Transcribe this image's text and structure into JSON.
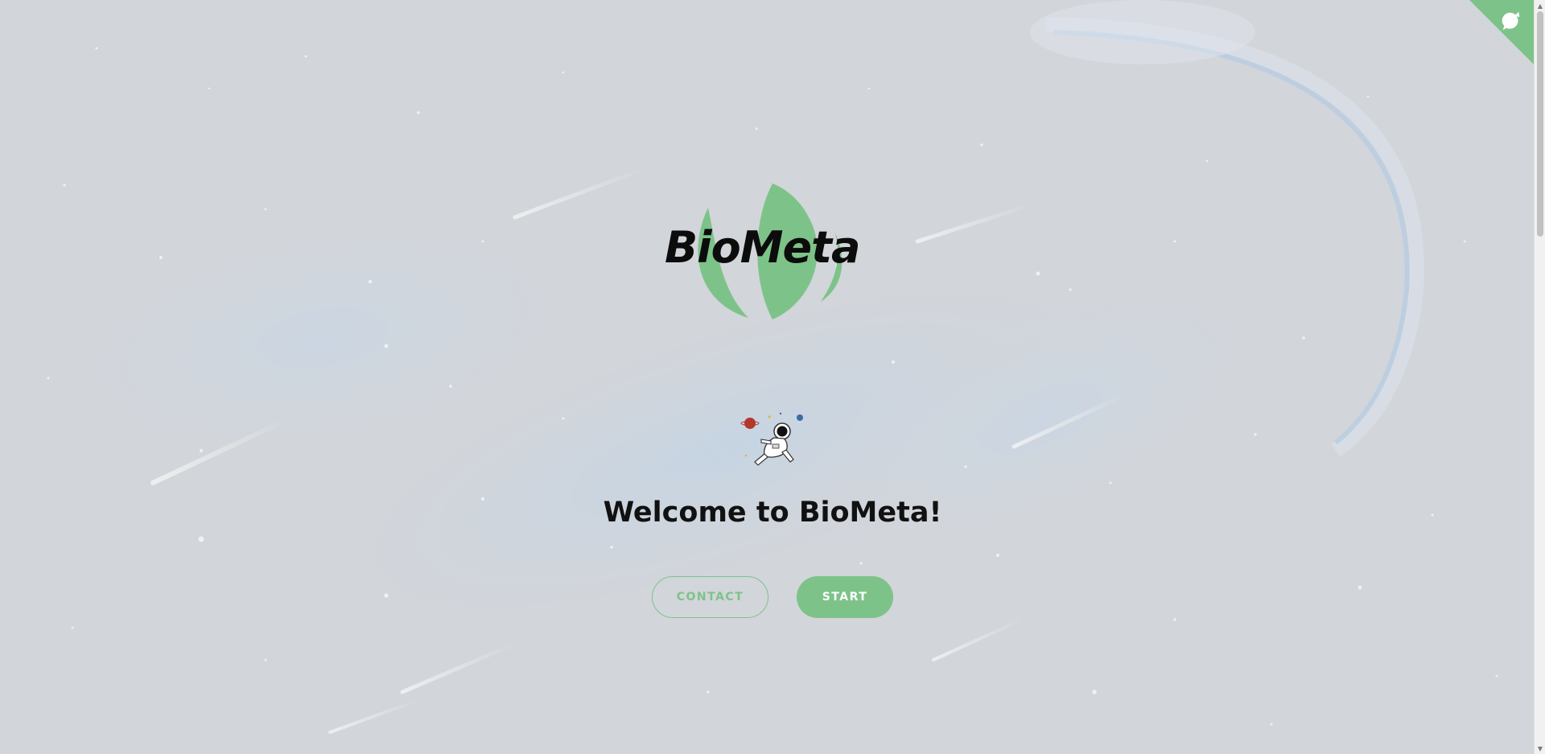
{
  "brand": {
    "logo_text": "BioMeta",
    "accent_color": "#7dc389"
  },
  "hero": {
    "welcome_text": "Welcome to BioMeta!",
    "astronaut_icon": "astronaut-illustration"
  },
  "actions": {
    "contact_label": "CONTACT",
    "start_label": "START"
  },
  "corner": {
    "icon": "github-octocat-icon",
    "color": "#7dc389"
  }
}
